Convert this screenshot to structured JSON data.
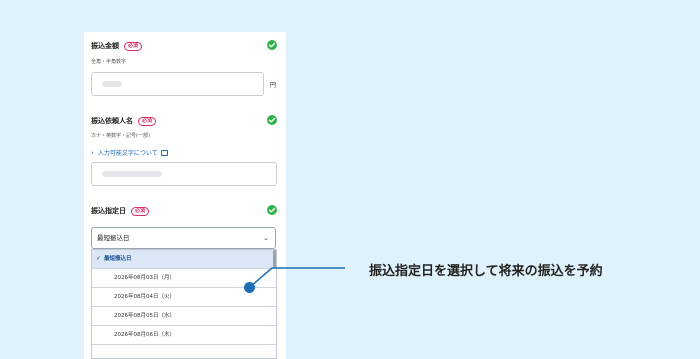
{
  "fields": {
    "amount": {
      "label": "振込金額",
      "badge": "必須",
      "hint": "全角・半角数字",
      "unit": "円"
    },
    "requester": {
      "label": "振込依頼人名",
      "badge": "必須",
      "hint": "カナ・英数字・記号(一部)",
      "link": "入力可能文字について"
    },
    "date": {
      "label": "振込指定日",
      "badge": "必須",
      "selected": "最短振込日",
      "options": [
        "最短振込日",
        "2026年08月03日（月）",
        "2026年08月04日（火）",
        "2026年08月05日（水）",
        "2026年08月06日（木）"
      ]
    }
  },
  "callout": {
    "text": "振込指定日を選択して将来の振込を予約"
  },
  "colors": {
    "background": "#dff1fb",
    "check": "#2fb34a",
    "required_badge": "#d9306b",
    "link": "#1a64b7",
    "callout_accent": "#1f6eb5"
  },
  "icons": [
    "check-circle-icon",
    "chevron-right-icon",
    "external-link-icon",
    "chevron-down-icon",
    "checkmark-icon"
  ]
}
